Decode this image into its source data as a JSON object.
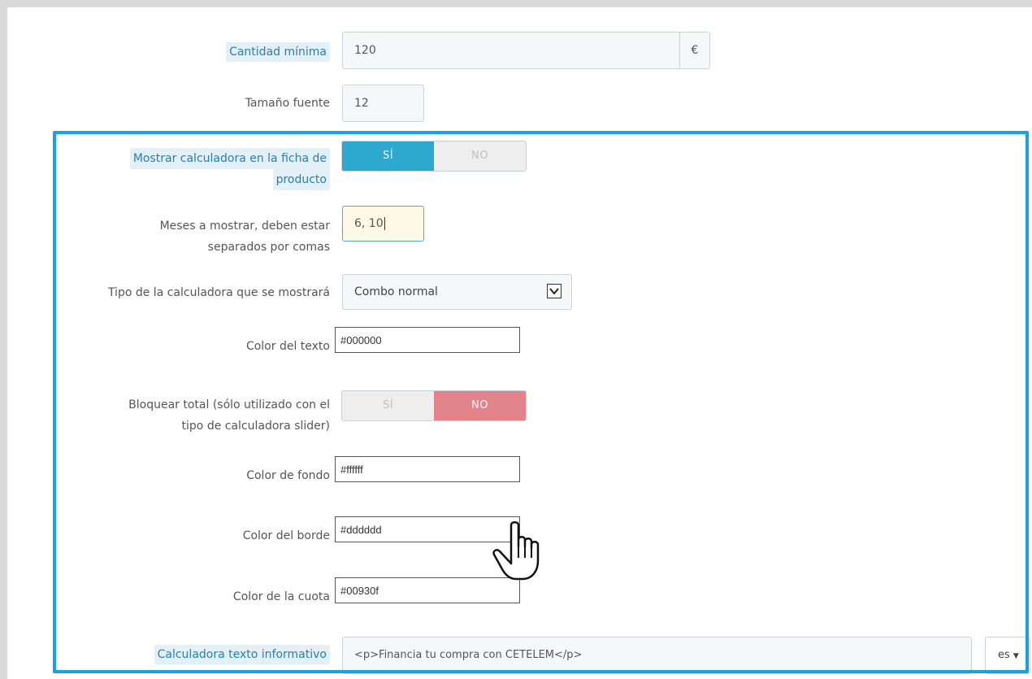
{
  "rows": {
    "cantidad_minima": {
      "label": "Cantidad mínima",
      "value": "120",
      "addon": "€"
    },
    "tamano_fuente": {
      "label": "Tamaño fuente",
      "value": "12"
    },
    "mostrar_calculadora": {
      "label_line1": "Mostrar calculadora en la ficha de",
      "label_line2": "producto",
      "yes": "SÍ",
      "no": "NO",
      "selected": "yes"
    },
    "meses": {
      "label_line1": "Meses a mostrar, deben estar",
      "label_line2": "separados por comas",
      "value": "6, 10"
    },
    "tipo_calculadora": {
      "label": "Tipo de la calculadora que se mostrará",
      "value": "Combo normal"
    },
    "color_texto": {
      "label": "Color del texto",
      "value": "#000000"
    },
    "bloquear_total": {
      "label_line1": "Bloquear total (sólo utilizado con el",
      "label_line2": "tipo de calculadora slider)",
      "yes": "SÍ",
      "no": "NO",
      "selected": "no"
    },
    "color_fondo": {
      "label": "Color de fondo",
      "value": "#ffffff"
    },
    "color_borde": {
      "label": "Color del borde",
      "value": "#dddddd"
    },
    "color_cuota": {
      "label": "Color de la cuota",
      "value": "#00930f"
    },
    "texto_informativo": {
      "label": "Calculadora texto informativo",
      "value": "<p>Financia tu compra con CETELEM</p>",
      "lang": "es"
    }
  },
  "colors": {
    "accent_blue": "#2ea8cf",
    "toggle_no_red": "#e0838a",
    "highlight_border": "#1aa1e0",
    "label_highlight_bg": "#e3f0f8"
  }
}
